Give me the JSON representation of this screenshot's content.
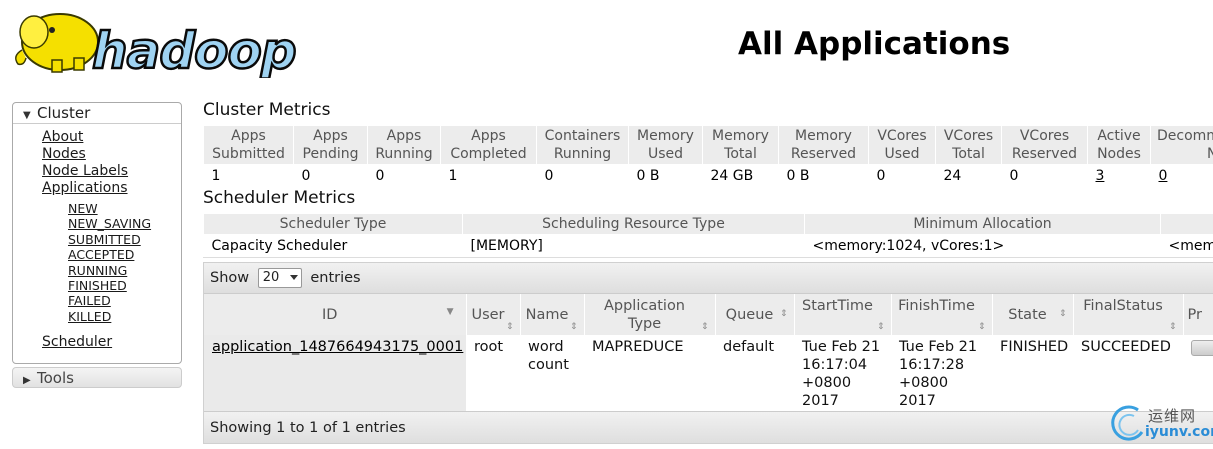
{
  "header": {
    "logo_text": "hadoop",
    "title": "All Applications"
  },
  "sidebar": {
    "cluster_label": "Cluster",
    "items": [
      "About",
      "Nodes",
      "Node Labels",
      "Applications"
    ],
    "app_states": [
      "NEW",
      "NEW_SAVING",
      "SUBMITTED",
      "ACCEPTED",
      "RUNNING",
      "FINISHED",
      "FAILED",
      "KILLED"
    ],
    "scheduler": "Scheduler",
    "tools_label": "Tools"
  },
  "cluster_metrics": {
    "title": "Cluster Metrics",
    "headers": [
      [
        "Apps",
        "Submitted"
      ],
      [
        "Apps",
        "Pending"
      ],
      [
        "Apps",
        "Running"
      ],
      [
        "Apps",
        "Completed"
      ],
      [
        "Containers",
        "Running"
      ],
      [
        "Memory",
        "Used"
      ],
      [
        "Memory",
        "Total"
      ],
      [
        "Memory",
        "Reserved"
      ],
      [
        "VCores",
        "Used"
      ],
      [
        "VCores",
        "Total"
      ],
      [
        "VCores",
        "Reserved"
      ],
      [
        "Active",
        "Nodes"
      ],
      [
        "Decomm",
        "Nod"
      ]
    ],
    "values": [
      "1",
      "0",
      "0",
      "1",
      "0",
      "0 B",
      "24 GB",
      "0 B",
      "0",
      "24",
      "0",
      "3",
      "0"
    ]
  },
  "scheduler_metrics": {
    "title": "Scheduler Metrics",
    "headers": [
      "Scheduler Type",
      "Scheduling Resource Type",
      "Minimum Allocation",
      ""
    ],
    "values": [
      "Capacity Scheduler",
      "[MEMORY]",
      "<memory:1024, vCores:1>",
      "<mem"
    ]
  },
  "apps_table": {
    "show_label": "Show",
    "page_size": "20",
    "entries_label": "entries",
    "headers": [
      [
        "ID"
      ],
      [
        "User"
      ],
      [
        "Name"
      ],
      [
        "Application",
        "Type"
      ],
      [
        "Queue"
      ],
      [
        "StartTime"
      ],
      [
        "FinishTime"
      ],
      [
        "State"
      ],
      [
        "FinalStatus"
      ],
      [
        "Pr"
      ]
    ],
    "rows": [
      {
        "id": "application_1487664943175_0001",
        "user": "root",
        "name": [
          "word",
          "count"
        ],
        "type": "MAPREDUCE",
        "queue": "default",
        "start": [
          "Tue Feb 21",
          "16:17:04",
          "+0800",
          "2017"
        ],
        "finish": [
          "Tue Feb 21",
          "16:17:28",
          "+0800",
          "2017"
        ],
        "state": "FINISHED",
        "final_status": "SUCCEEDED"
      }
    ],
    "footer": "Showing 1 to 1 of 1 entries"
  },
  "watermark": {
    "line1": "运维网",
    "line2": "iyunv.com"
  }
}
